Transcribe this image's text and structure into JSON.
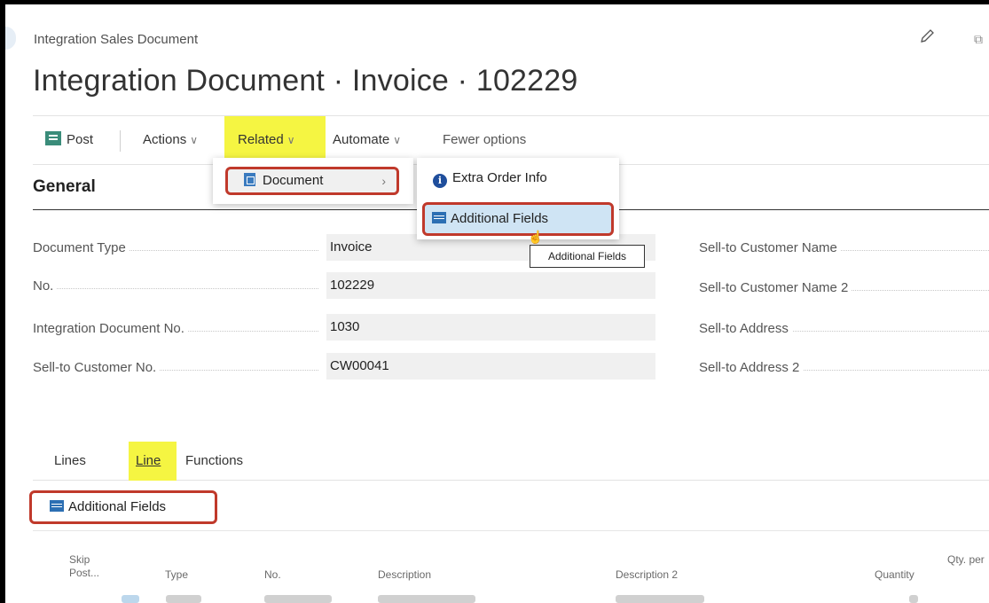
{
  "header": {
    "breadcrumb": "Integration Sales Document",
    "title": "Integration Document · Invoice · 102229"
  },
  "actionbar": {
    "post": "Post",
    "actions": "Actions",
    "related": "Related",
    "automate": "Automate",
    "fewer": "Fewer options"
  },
  "menu": {
    "document": "Document",
    "extra_order_info": "Extra Order Info",
    "additional_fields": "Additional Fields",
    "tooltip": "Additional Fields"
  },
  "general": {
    "title": "General",
    "fields": [
      {
        "label": "Document Type",
        "value": "Invoice"
      },
      {
        "label": "No.",
        "value": "102229"
      },
      {
        "label": "Integration Document No.",
        "value": "1030"
      },
      {
        "label": "Sell-to Customer No.",
        "value": "CW00041"
      }
    ],
    "right_fields": [
      {
        "label": "Sell-to Customer Name"
      },
      {
        "label": "Sell-to Customer Name 2"
      },
      {
        "label": "Sell-to Address"
      },
      {
        "label": "Sell-to Address 2"
      }
    ]
  },
  "lines": {
    "tabs": [
      "Lines",
      "Line",
      "Functions"
    ],
    "additional_fields": "Additional Fields",
    "columns": {
      "skip_line1": "Skip",
      "skip_line2": "Post...",
      "type": "Type",
      "no": "No.",
      "description": "Description",
      "description2": "Description 2",
      "quantity": "Quantity",
      "qty_per": "Qty. per"
    }
  },
  "colors": {
    "highlight": "#f5f542",
    "callout": "#c0392b",
    "hover": "#cfe4f4"
  }
}
